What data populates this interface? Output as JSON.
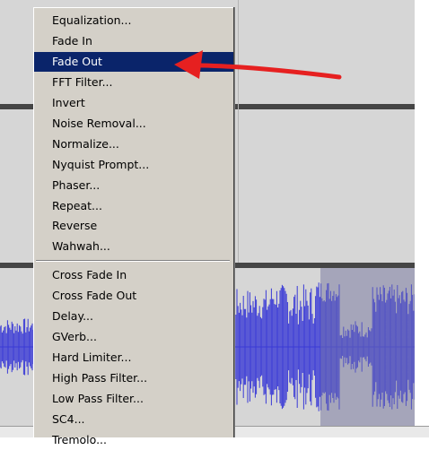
{
  "colors": {
    "menu_bg": "#d4d0c8",
    "highlight": "#0a246a",
    "waveform": "#3a3ad6",
    "arrow": "#e62020"
  },
  "menu": {
    "items": [
      {
        "label": "Equalization..."
      },
      {
        "label": "Fade In"
      },
      {
        "label": "Fade Out"
      },
      {
        "label": "FFT Filter..."
      },
      {
        "label": "Invert"
      },
      {
        "label": "Noise Removal..."
      },
      {
        "label": "Normalize..."
      },
      {
        "label": "Nyquist Prompt..."
      },
      {
        "label": "Phaser..."
      },
      {
        "label": "Repeat..."
      },
      {
        "label": "Reverse"
      },
      {
        "label": "Wahwah..."
      },
      {
        "label": "Cross Fade In"
      },
      {
        "label": "Cross Fade Out"
      },
      {
        "label": "Delay..."
      },
      {
        "label": "GVerb..."
      },
      {
        "label": "Hard Limiter..."
      },
      {
        "label": "High Pass Filter..."
      },
      {
        "label": "Low Pass Filter..."
      },
      {
        "label": "SC4..."
      },
      {
        "label": "Tremolo..."
      }
    ],
    "selected_label": "Fade Out"
  },
  "annotation": {
    "icon": "red-arrow-icon"
  }
}
